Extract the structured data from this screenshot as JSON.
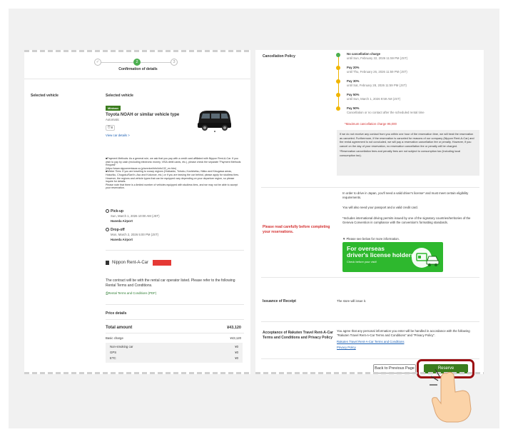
{
  "steps": {
    "check_icon": "check-icon",
    "current_num": "2",
    "current_label": "Confirmation of details",
    "next_num": "3"
  },
  "left": {
    "section_label": "Selected vehicle",
    "vehicle": {
      "heading": "Selected vehicle",
      "badge": "Minivan",
      "name": "Toyota NOAH or similar vehicle type",
      "transmission": "Automatic",
      "seats": "8",
      "details_link": "View car details >"
    },
    "notes": [
      "■Payment Methods: As a general rule, we ask that you pay with a credit card affiliated with Nippon Rent-A-Car. If you wish to pay by cash (excluding electronic money, VISA debit cards, etc.), please check the separate \"Payment Methods Request\"",
      "(https://www.nipponrentacar.co.jp/service/info/info132_en.htm)",
      "■Winter Tires: If you are traveling to snowy regions (Hokkaido, Tohoku, Koshinetsu, Nikko and Kinugawa areas, Hokuriku, Chugoku/San'in, Aso and Kokonoe, etc.) or if you are leaving the car behind, please apply for studless tires.",
      "However, the regions and vehicle types that can be equipped vary depending on your departure region, so please inquire for details.",
      "Please note that there is a limited number of vehicles equipped with studless tires, and we may not be able to accept your reservation."
    ],
    "pickup": {
      "label": "Pick-up",
      "date": "Sun, March 1, 2026 10:00 AM (JST)",
      "place": "Haneda Airport"
    },
    "dropoff": {
      "label": "Drop-off",
      "date": "Mon, March 2, 2026 5:00 PM (JST)",
      "place": "Haneda Airport"
    },
    "company": {
      "name": "Nippon Rent-A-Car",
      "logo_text": "NIPPON RENTACAR",
      "contract_text": "The contract will be with the rental car operator listed. Please refer to the following Rental Terms and Conditions.",
      "terms_link": "Rental Terms and Conditions (PDF)"
    },
    "price": {
      "heading": "Price details",
      "total_label": "Total amount",
      "total_value": "¥43,120",
      "basic_label": "Basic charge",
      "basic_value": "¥43,120",
      "items": [
        {
          "label": "Non-smoking car",
          "value": "¥0"
        },
        {
          "label": "GPS",
          "value": "¥0"
        },
        {
          "label": "ETC",
          "value": "¥0"
        }
      ]
    }
  },
  "right": {
    "cancel": {
      "label": "Cancellation Policy",
      "timeline": [
        {
          "title": "No cancellation charge",
          "sub": "until Sun, February 22, 2026 11:59 PM (JST)"
        },
        {
          "title": "Pay 20%",
          "sub": "until Thu, February 26, 2026 11:59 PM (JST)"
        },
        {
          "title": "Pay 30%",
          "sub": "until Sat, February 28, 2026 11:59 PM (JST)"
        },
        {
          "title": "Pay 50%",
          "sub": "until Sun, March 1, 2026 9:59 AM (JST)"
        },
        {
          "title": "Pay 50%",
          "sub": "Cancellation or no contact after the scheduled rental time"
        }
      ],
      "max_charge": "*Maximum cancellation charge ¥6,000",
      "note": "If we do not receive any contact from you within one hour of the reservation time, we will treat the reservation as canceled. Furthermore, if the reservation is canceled for reasons of our company (Nippon Rent-A-Car) and the rental agreement is not concluded, we will pay a reservation cancellation fee or penalty. However, if you cancel on the day of your reservation, no reservation cancellation fee or penalty will be charged.",
      "note2": "*Reservation cancellation fees and penalty fees are not subject to consumption tax (including local consumption tax)."
    },
    "read": {
      "label": "Please read carefully before completing your reservations.",
      "p1": "In order to drive in Japan, you'll need a valid driver's license* and must meet certain eligibility requirements.",
      "p2": "You will also need your passport and a valid credit card.",
      "p3": "*Includes international driving permits issued by one of the signatory countries/territories of the Geneva Convention in compliance with the convention's formatting standards.",
      "see_below": "▼ Please see below for more information.",
      "banner_line1": "For overseas",
      "banner_line2": "driver's license holders",
      "banner_line3": "Check before your visit!"
    },
    "receipt": {
      "label": "Issuance of Receipt",
      "text": "The store will issue it."
    },
    "accept": {
      "label": "Acceptance of Rakuten Travel Rent-A-Car Terms and Conditions and Privacy Policy",
      "text": "You agree that any personal information you enter will be handled in accordance with the following \"Rakuten Travel Rent-A-Car Terms and Conditions\" and \"Privacy Policy\".",
      "link1": "Rakuten Travel Rent-A-Car Terms and Conditions",
      "link2": "Privacy Policy"
    },
    "back_button": "Back to Previous Page",
    "reserve_button": "Reserve"
  },
  "colors": {
    "accent_green": "#3b7d1e",
    "highlight": "#9b0e12",
    "warning_red": "#d32f2f",
    "timeline_yellow": "#f0b400"
  }
}
